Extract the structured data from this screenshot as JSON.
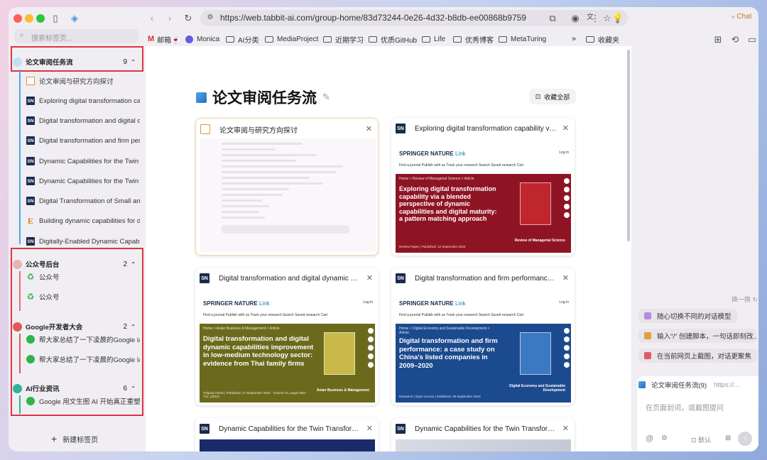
{
  "browser": {
    "url": "https://web.tabbit-ai.com/group-home/83d73244-0e26-4d32-b8db-ee00868b9759",
    "chat_button": "Chat"
  },
  "bookmarks": [
    {
      "icon": "gmail-icon",
      "label": "邮箱🍷"
    },
    {
      "icon": "monica-icon",
      "label": "Monica"
    },
    {
      "icon": "folder-icon",
      "label": "AI分类"
    },
    {
      "icon": "folder-icon",
      "label": "MediaProject"
    },
    {
      "icon": "folder-icon",
      "label": "近期学习"
    },
    {
      "icon": "folder-icon",
      "label": "优质GitHub"
    },
    {
      "icon": "folder-icon",
      "label": "Life"
    },
    {
      "icon": "folder-icon",
      "label": "优秀博客"
    },
    {
      "icon": "folder-icon",
      "label": "MetaTuring"
    },
    {
      "icon": "folder-icon",
      "label": "收藏夹"
    }
  ],
  "sidebar": {
    "search_placeholder": "搜索标签页...",
    "groups": [
      {
        "name": "论文审阅任务流",
        "count": "9",
        "items": [
          {
            "icon": "chat",
            "title": "论文审阅与研究方向探讨"
          },
          {
            "icon": "sn",
            "title": "Exploring digital transformation capability"
          },
          {
            "icon": "sn",
            "title": "Digital transformation and digital dynamic"
          },
          {
            "icon": "sn",
            "title": "Digital transformation and firm performance"
          },
          {
            "icon": "sn",
            "title": "Dynamic Capabilities for the Twin Transformation"
          },
          {
            "icon": "sn",
            "title": "Dynamic Capabilities for the Twin Transformation"
          },
          {
            "icon": "sn",
            "title": "Digital Transformation of Small and medium"
          },
          {
            "icon": "e",
            "title": "Building dynamic capabilities for digital"
          },
          {
            "icon": "sn",
            "title": "Digitally-Enabled Dynamic Capabilities"
          }
        ]
      },
      {
        "name": "公众号后台",
        "count": "2",
        "items": [
          {
            "icon": "gzh",
            "title": "公众号"
          },
          {
            "icon": "gzh",
            "title": "公众号"
          }
        ]
      },
      {
        "name": "Google开发者大会",
        "count": "2",
        "items": [
          {
            "icon": "wx",
            "title": "帮大家总结了一下凌晨的Google I/O"
          },
          {
            "icon": "wx",
            "title": "帮大家总结了一下凌晨的Google I/O"
          }
        ]
      },
      {
        "name": "AI行业资讯",
        "count": "6",
        "items": [
          {
            "icon": "wx",
            "title": "Google 用文生图 AI 开始真正重塑"
          }
        ]
      }
    ],
    "new_tab": "新建标签页"
  },
  "main": {
    "title": "论文审阅任务流",
    "favorite_all": "收藏全部",
    "cards": [
      {
        "icon": "chat",
        "title": "论文审阅与研究方向探讨",
        "thumb": "chat"
      },
      {
        "icon": "sn",
        "title": "Exploring digital transformation capability via a blended perspective of dynamic capabilities and digital maturity",
        "thumb": "sn",
        "hero_title": "Exploring digital transformation capability via a blended perspective of dynamic capabilities and digital maturity: a pattern matching approach",
        "breadcrumb": "Home > Review of Managerial Science > Article",
        "meta": "Review Paper | Published: 12 September 2023",
        "cover_label": "Review of Managerial Science",
        "hero_color": "#8e1424",
        "cover_color": "#c0262e"
      },
      {
        "icon": "sn",
        "title": "Digital transformation and digital dynamic capabilities improvement",
        "thumb": "sn",
        "hero_title": "Digital transformation and digital dynamic capabilities improvement in low-medium technology sector: evidence from Thai family firms",
        "breadcrumb": "Home > Asian Business & Management > Article",
        "meta": "Original Article | Published: 17 September 2024 · Volume 23, pages 683–712, (2024)",
        "cover_label": "Asian Business & Management",
        "hero_color": "#6b6a1c",
        "cover_color": "#c9b84a"
      },
      {
        "icon": "sn",
        "title": "Digital transformation and firm performance: a case study on China's listed companies",
        "thumb": "sn",
        "hero_title": "Digital transformation and firm performance: a case study on China's listed companies in 2009–2020",
        "breadcrumb": "Home > Digital Economy and Sustainable Development > Article",
        "meta": "Research | Open access | Published: 28 September 2023",
        "cover_label": "Digital Economy and Sustainable Development",
        "hero_color": "#1c4a8e",
        "cover_color": "#3d78c4"
      },
      {
        "icon": "sn",
        "title": "Dynamic Capabilities for the Twin Transformation",
        "thumb": "cut"
      },
      {
        "icon": "sn",
        "title": "Dynamic Capabilities for the Twin Transformation",
        "thumb": "cut"
      }
    ],
    "thumb_brand": "SPRINGER NATURE",
    "thumb_brand_link": "Link",
    "thumb_login": "Log in",
    "thumb_nav": "Find a journal    Publish with us    Track your research          Search    Saved research    Cart"
  },
  "assistant": {
    "refresh": "换一换",
    "suggestions": [
      {
        "icon": "model-switch-icon",
        "color": "#b58be0",
        "text": "随心切换不同的对话模型"
      },
      {
        "icon": "script-icon",
        "color": "#e0a03a",
        "text": "输入\"/\" 创建脚本，一句话即刻改..."
      },
      {
        "icon": "screenshot-icon",
        "color": "#e05a6a",
        "text": "在当前网页上截图，对话更聚焦"
      }
    ],
    "context_label": "论文审阅任务流(9)",
    "context_url": "https://...",
    "input_placeholder": "在页面划词，或截图提问",
    "default_label": "默认"
  }
}
